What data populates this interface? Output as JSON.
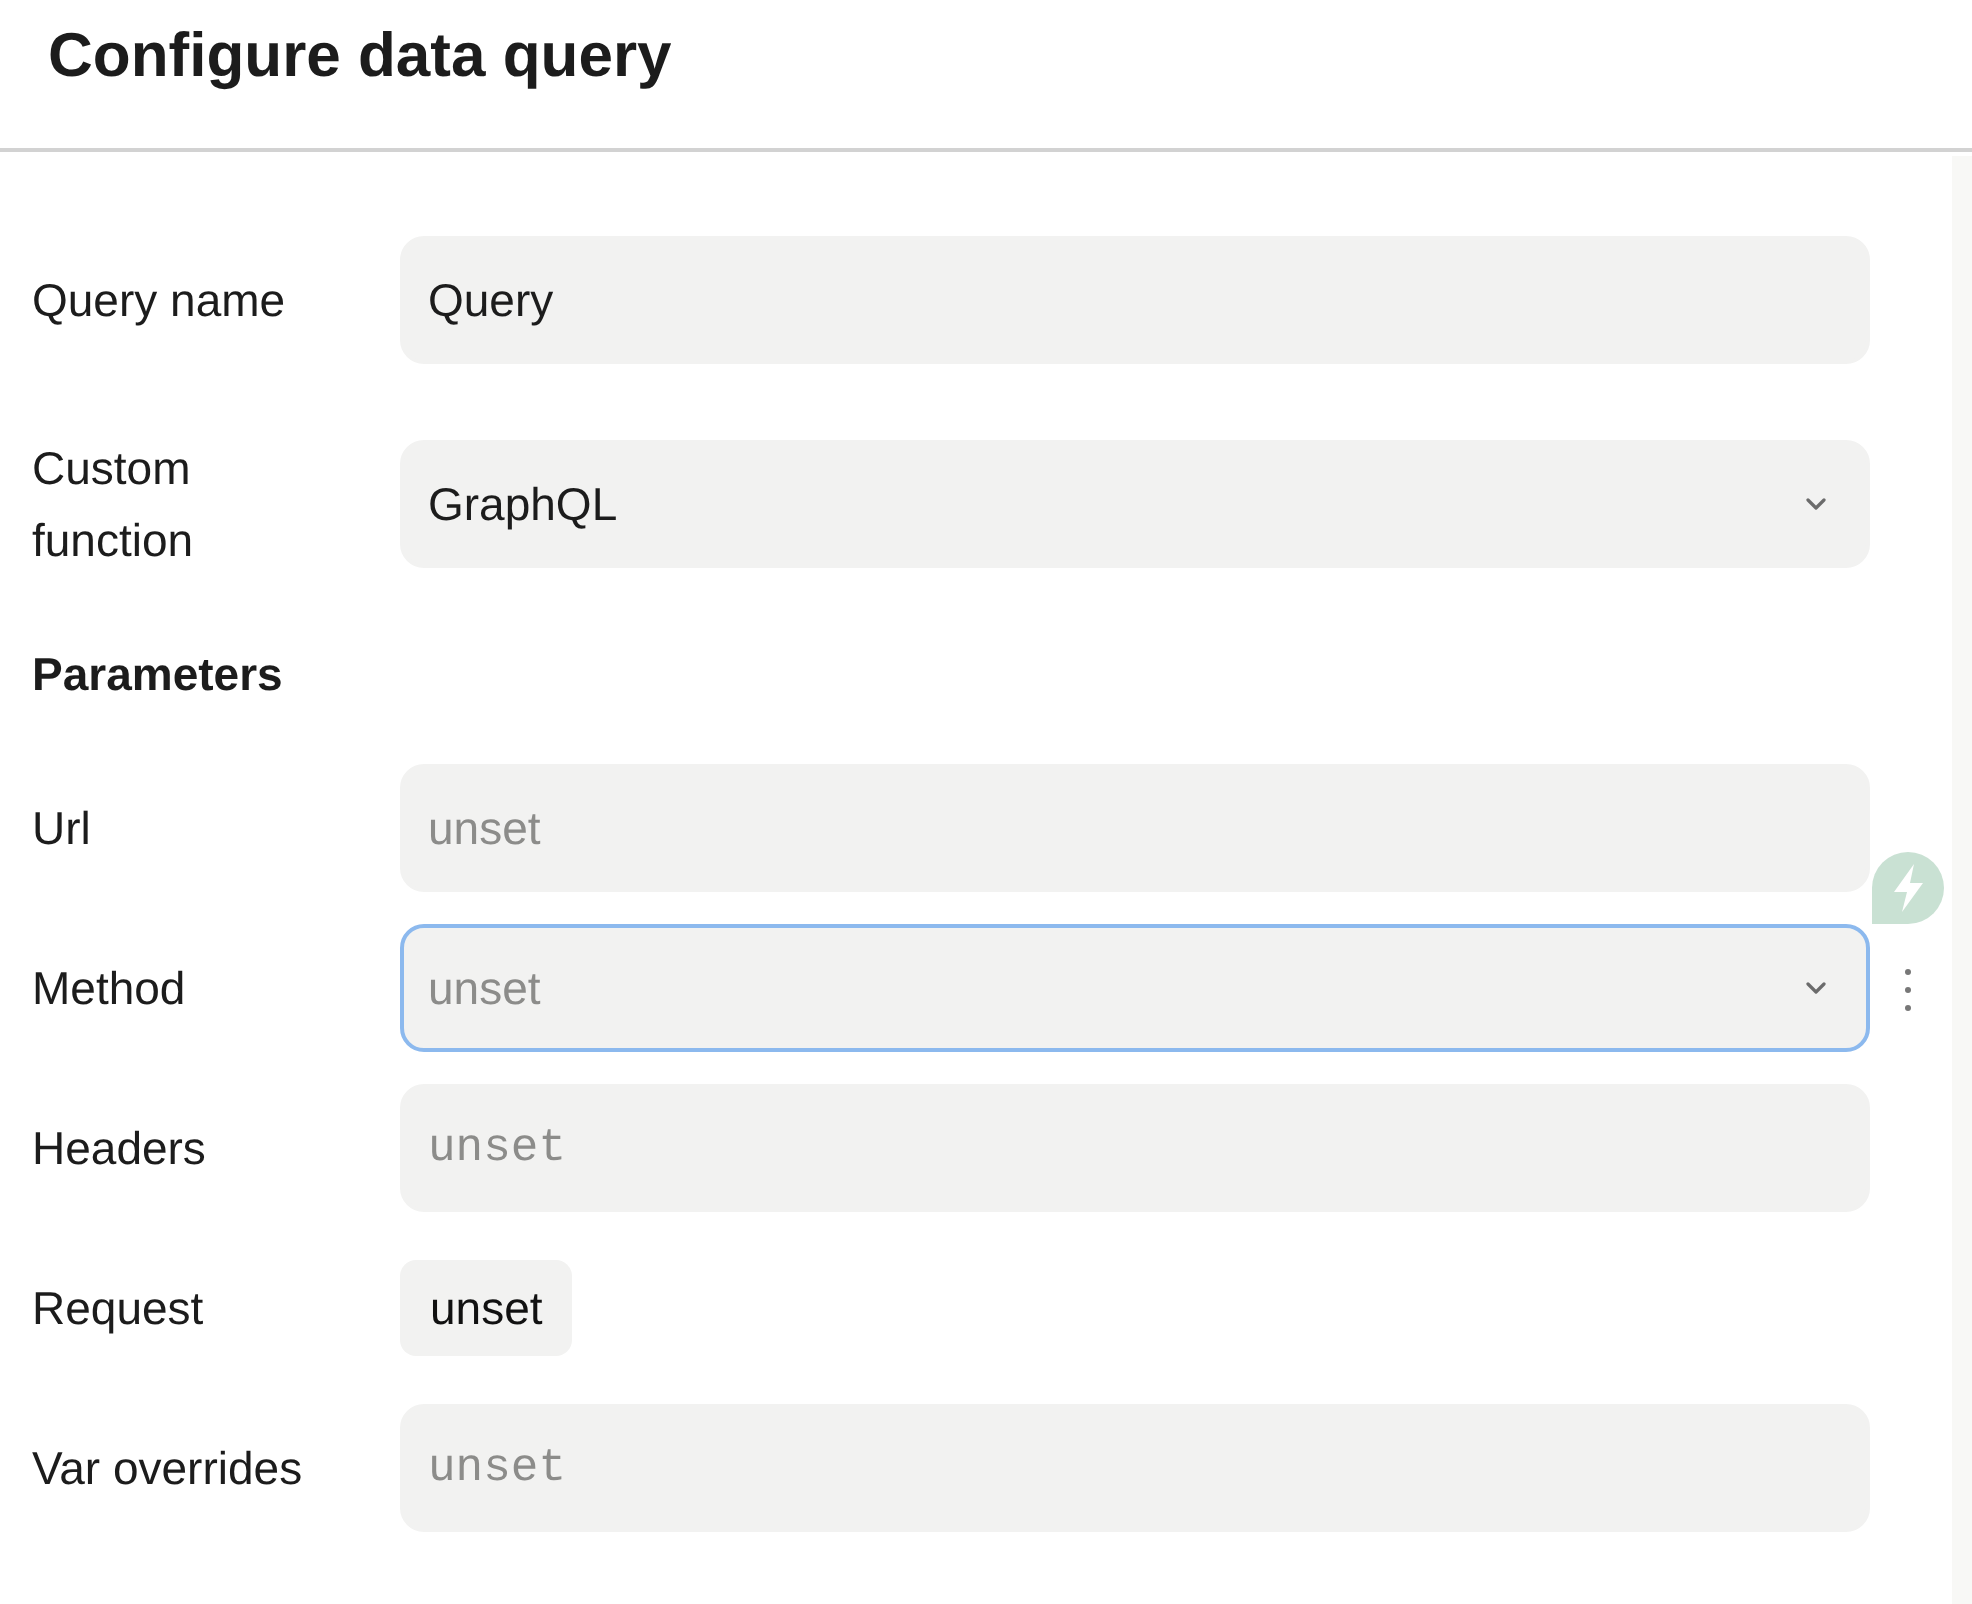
{
  "header": {
    "title": "Configure data query"
  },
  "fields": [
    {
      "label": "Query name",
      "kind": "text",
      "value": "Query"
    },
    {
      "label": "Custom function",
      "kind": "select",
      "value": "GraphQL"
    }
  ],
  "parameters": {
    "heading": "Parameters",
    "fields": [
      {
        "label": "Url",
        "kind": "text",
        "placeholder": "unset",
        "focused": false,
        "hovered": false
      },
      {
        "label": "Method",
        "kind": "select",
        "placeholder": "unset",
        "focused": true,
        "hovered": true
      },
      {
        "label": "Headers",
        "kind": "code",
        "placeholder": "unset",
        "focused": false,
        "hovered": false
      },
      {
        "label": "Request",
        "kind": "button",
        "value": "unset",
        "focused": false,
        "hovered": false
      },
      {
        "label": "Var overrides",
        "kind": "code",
        "placeholder": "unset",
        "focused": false,
        "hovered": false
      }
    ]
  }
}
